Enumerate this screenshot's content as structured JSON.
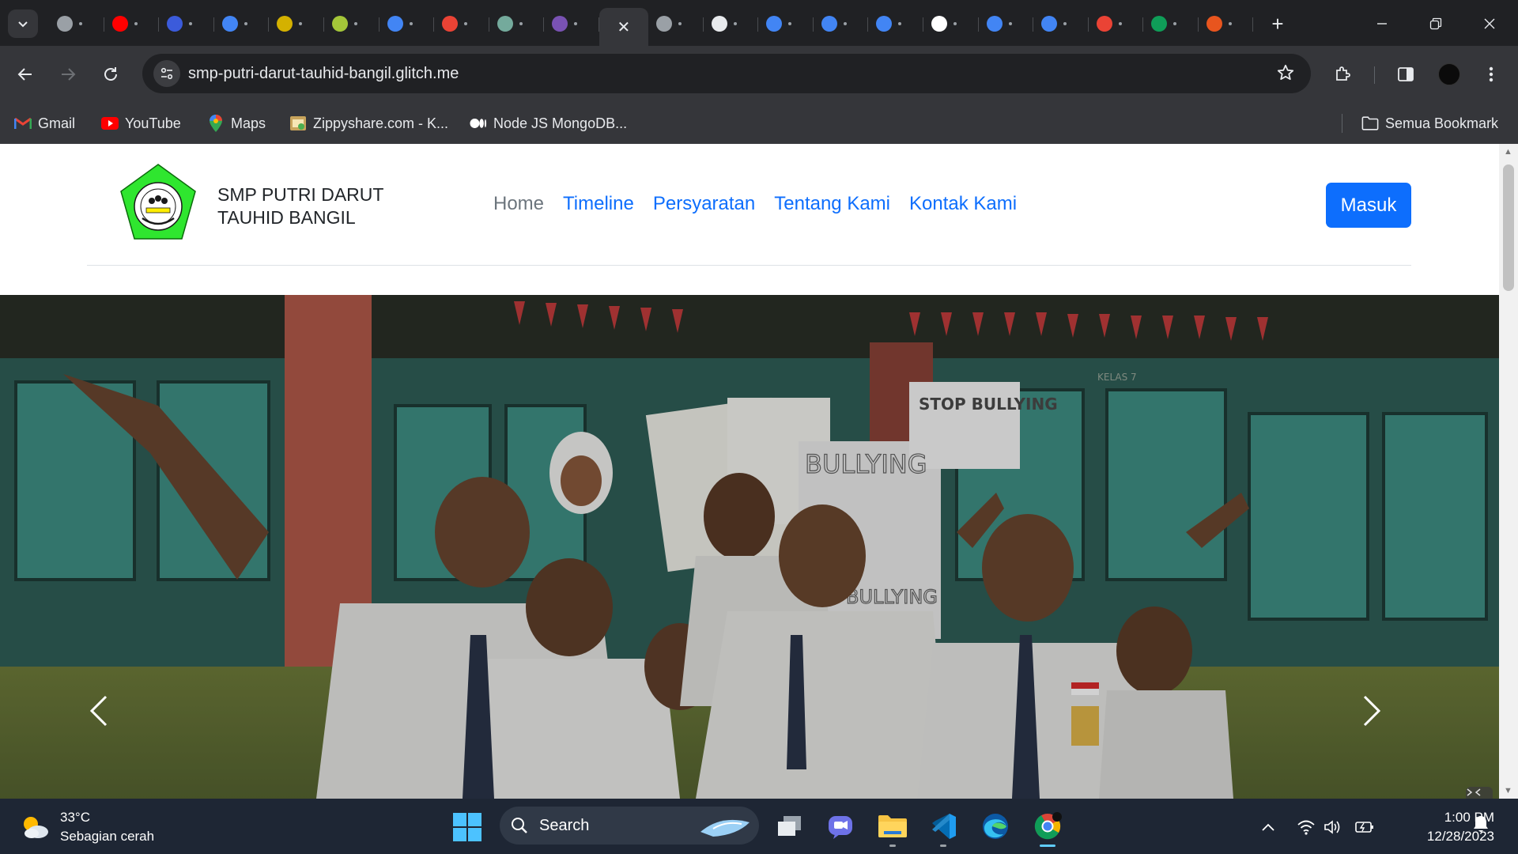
{
  "browser": {
    "tabs": [
      {
        "icon": "tab-search-icon",
        "color": "#35363a"
      },
      {
        "icon": "globe-icon",
        "color": "#9aa0a6"
      },
      {
        "icon": "youtube-icon",
        "color": "#ff0000"
      },
      {
        "icon": "site-banner-icon",
        "color": "#3b5bdb"
      },
      {
        "icon": "google-icon",
        "color": "#4285f4"
      },
      {
        "icon": "emblem-icon",
        "color": "#d4b100"
      },
      {
        "icon": "school-logo-icon",
        "color": "#a4c639"
      },
      {
        "icon": "google-icon",
        "color": "#4285f4"
      },
      {
        "icon": "gmail-icon",
        "color": "#ea4335"
      },
      {
        "icon": "chatgpt-icon",
        "color": "#74aa9c"
      },
      {
        "icon": "bootstrap-icon",
        "color": "#7952b3"
      },
      {
        "icon": "active-tab-close-icon",
        "color": "#35363a"
      },
      {
        "icon": "globe-icon",
        "color": "#9aa0a6"
      },
      {
        "icon": "speedometer-icon",
        "color": "#e8eaed"
      },
      {
        "icon": "docs-icon",
        "color": "#4285f4"
      },
      {
        "icon": "docs-icon",
        "color": "#4285f4"
      },
      {
        "icon": "docs-icon",
        "color": "#4285f4"
      },
      {
        "icon": "github-icon",
        "color": "#ffffff"
      },
      {
        "icon": "google-icon",
        "color": "#4285f4"
      },
      {
        "icon": "google-icon",
        "color": "#4285f4"
      },
      {
        "icon": "gmail-icon",
        "color": "#ea4335"
      },
      {
        "icon": "drive-icon",
        "color": "#0f9d58"
      },
      {
        "icon": "brand-icon",
        "color": "#e8551e"
      }
    ],
    "url": "smp-putri-darut-tauhid-bangil.glitch.me",
    "bookmarks": [
      {
        "label": "Gmail",
        "icon": "gmail-icon"
      },
      {
        "label": "YouTube",
        "icon": "youtube-icon"
      },
      {
        "label": "Maps",
        "icon": "maps-pin-icon"
      },
      {
        "label": "Zippyshare.com - K...",
        "icon": "zippyshare-icon"
      },
      {
        "label": "Node JS MongoDB...",
        "icon": "medium-icon"
      }
    ],
    "all_bookmarks_label": "Semua Bookmark"
  },
  "site": {
    "brand_line1": "SMP PUTRI DARUT",
    "brand_line2": "TAUHID BANGIL",
    "nav": [
      "Home",
      "Timeline",
      "Persyaratan",
      "Tentang Kami",
      "Kontak Kami"
    ],
    "active_nav": "Home",
    "login_button": "Masuk",
    "hero_signs": [
      "STOP BULLYING",
      "BULLYING",
      "BULLYING",
      "KELAS 7"
    ],
    "colors": {
      "primary": "#0d6efd",
      "muted": "#6c757d",
      "logo_green": "#2fe62f"
    }
  },
  "taskbar": {
    "temperature": "33°C",
    "weather_desc": "Sebagian cerah",
    "search_placeholder": "Search",
    "time": "1:00 PM",
    "date": "12/28/2023"
  }
}
